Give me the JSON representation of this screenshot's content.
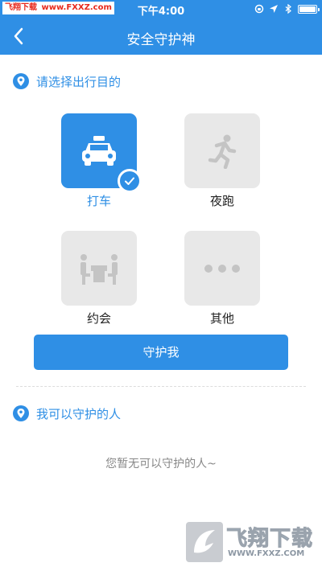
{
  "status_bar": {
    "watermark_brand": "飞翔下载",
    "watermark_url": "www.FXXZ.com",
    "time": "下午4:00"
  },
  "header": {
    "title": "安全守护神"
  },
  "purpose_section": {
    "heading": "请选择出行目的",
    "options": [
      {
        "label": "打车",
        "icon": "taxi-icon",
        "selected": true
      },
      {
        "label": "夜跑",
        "icon": "running-icon",
        "selected": false
      },
      {
        "label": "约会",
        "icon": "dating-icon",
        "selected": false
      },
      {
        "label": "其他",
        "icon": "more-icon",
        "selected": false
      }
    ]
  },
  "guard_button": {
    "label": "守护我"
  },
  "guardian_section": {
    "heading": "我可以守护的人",
    "empty_text": "您暂无可以守护的人~"
  },
  "watermark": {
    "brand": "飞翔下载",
    "url": "WWW.FXXZ.COM"
  },
  "colors": {
    "primary": "#2f8fe5",
    "tile_inactive": "#e8e8e8",
    "icon_inactive": "#c4c4c4"
  }
}
